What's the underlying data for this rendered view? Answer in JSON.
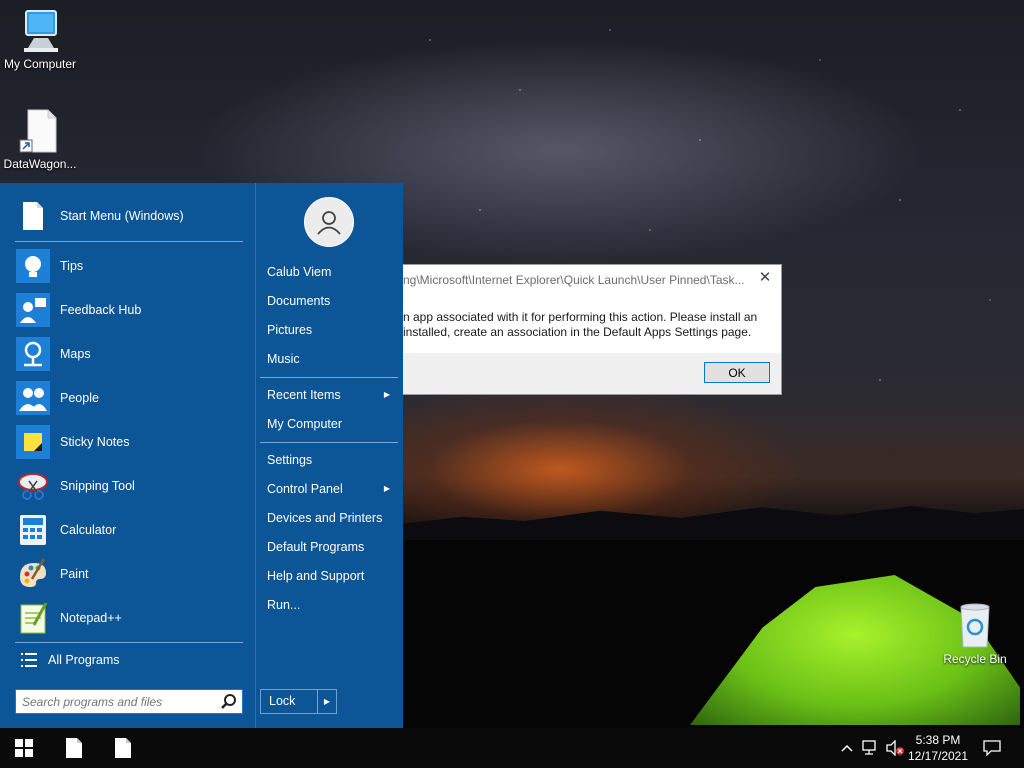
{
  "desktop": {
    "icons": [
      {
        "label": "My Computer",
        "icon": "computer-icon"
      },
      {
        "label": "DataWagon...",
        "icon": "file-shortcut-icon"
      },
      {
        "label": "Recycle Bin",
        "icon": "recycle-bin-icon"
      }
    ]
  },
  "dialog": {
    "title": "ng\\Microsoft\\Internet Explorer\\Quick Launch\\User Pinned\\Task...",
    "message_line1": "n app associated with it for performing this action. Please install an",
    "message_line2": "installed, create an association in the Default Apps Settings page.",
    "ok_label": "OK",
    "close_icon": "close-icon"
  },
  "start_menu": {
    "pinned": {
      "label": "Start Menu (Windows)",
      "icon": "document-icon"
    },
    "programs": [
      {
        "label": "Tips",
        "icon": "lightbulb-icon"
      },
      {
        "label": "Feedback Hub",
        "icon": "feedback-hub-icon"
      },
      {
        "label": "Maps",
        "icon": "maps-icon"
      },
      {
        "label": "People",
        "icon": "people-icon"
      },
      {
        "label": "Sticky Notes",
        "icon": "sticky-notes-icon"
      },
      {
        "label": "Snipping Tool",
        "icon": "scissors-icon"
      },
      {
        "label": "Calculator",
        "icon": "calculator-icon"
      },
      {
        "label": "Paint",
        "icon": "palette-icon"
      },
      {
        "label": "Notepad++",
        "icon": "notepad-plus-plus-icon"
      }
    ],
    "all_programs": "All Programs",
    "search_placeholder": "Search programs and files",
    "right": {
      "user_name": "Calub Viem",
      "items_group1": [
        "Documents",
        "Pictures",
        "Music"
      ],
      "recent_items": "Recent Items",
      "my_computer": "My Computer",
      "settings": "Settings",
      "control_panel": "Control Panel",
      "devices_printers": "Devices and Printers",
      "default_programs": "Default Programs",
      "help_support": "Help and Support",
      "run": "Run...",
      "lock": "Lock"
    }
  },
  "taskbar": {
    "time": "5:38 PM",
    "date": "12/17/2021"
  },
  "colors": {
    "start_menu_bg": "#0c5596",
    "dialog_ok_border": "#0078d7",
    "taskbar_bg": "#0a0a0a"
  }
}
